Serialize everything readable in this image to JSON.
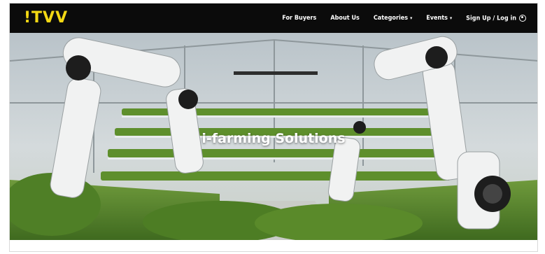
{
  "brand": {
    "logo": "!TVV",
    "logo_color": "#f3d814"
  },
  "nav": {
    "items": [
      {
        "label": "For Buyers",
        "dropdown": false
      },
      {
        "label": "About Us",
        "dropdown": false
      },
      {
        "label": "Categories",
        "dropdown": true
      },
      {
        "label": "Events",
        "dropdown": true
      },
      {
        "label": "Sign Up / Log in",
        "dropdown": false,
        "icon": "user-icon"
      }
    ]
  },
  "hero": {
    "title": "i-farming Solutions"
  },
  "colors": {
    "navbar": "#0b0b0b",
    "accent": "#f3d814"
  }
}
